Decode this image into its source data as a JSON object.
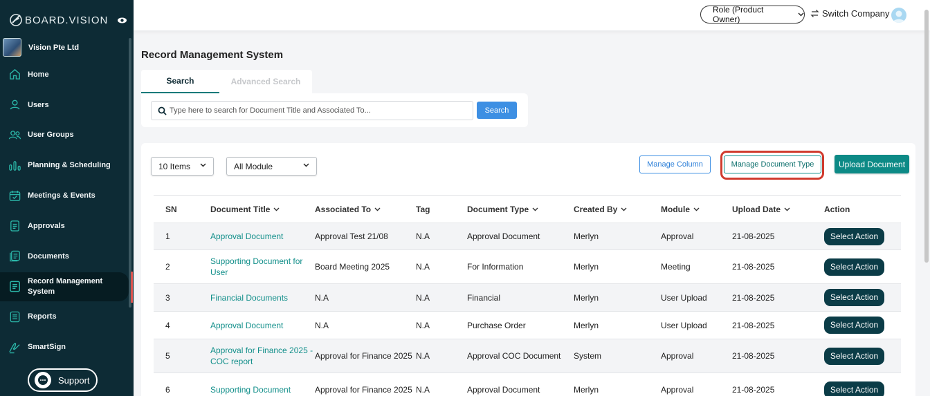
{
  "app": {
    "logo_text": "BOARD.VISION",
    "company_name": "Vision Pte Ltd"
  },
  "sidebar": {
    "items": [
      {
        "label": "Home",
        "icon": "home-icon"
      },
      {
        "label": "Users",
        "icon": "user-icon"
      },
      {
        "label": "User Groups",
        "icon": "user-groups-icon"
      },
      {
        "label": "Planning & Scheduling",
        "icon": "bar-chart-icon"
      },
      {
        "label": "Meetings & Events",
        "icon": "calendar-icon"
      },
      {
        "label": "Approvals",
        "icon": "clipboard-icon"
      },
      {
        "label": "Documents",
        "icon": "documents-icon"
      },
      {
        "label": "Record Management System",
        "icon": "record-icon",
        "active": true
      },
      {
        "label": "Reports",
        "icon": "report-icon"
      },
      {
        "label": "SmartSign",
        "icon": "signature-icon"
      }
    ],
    "support_label": "Support"
  },
  "topbar": {
    "role_label": "Role (Product Owner)",
    "switch_company_label": "Switch Company"
  },
  "main": {
    "title": "Record Management System",
    "tabs": {
      "search": "Search",
      "advanced": "Advanced Search"
    },
    "search": {
      "placeholder": "Type here to search for Document Title and Associated To...",
      "button_label": "Search"
    },
    "filters": {
      "items_per_page": "10 Items",
      "module": "All Module"
    },
    "buttons": {
      "manage_column": "Manage Column",
      "manage_document_type": "Manage Document Type",
      "upload_document": "Upload Document"
    },
    "table": {
      "headers": {
        "sn": "SN",
        "title": "Document Title",
        "associated": "Associated To",
        "tag": "Tag",
        "type": "Document Type",
        "created": "Created By",
        "module": "Module",
        "date": "Upload Date",
        "action": "Action"
      },
      "rows": [
        {
          "sn": "1",
          "title": "Approval Document",
          "associated": "Approval Test 21/08",
          "tag": "N.A",
          "type": "Approval Document",
          "created": "Merlyn",
          "module": "Approval",
          "date": "21-08-2025",
          "action": "Select Action"
        },
        {
          "sn": "2",
          "title": "Supporting Document for User",
          "associated": "Board Meeting 2025",
          "tag": "N.A",
          "type": "For Information",
          "created": "Merlyn",
          "module": "Meeting",
          "date": "21-08-2025",
          "action": "Select Action"
        },
        {
          "sn": "3",
          "title": "Financial Documents",
          "associated": "N.A",
          "tag": "N.A",
          "type": "Financial",
          "created": "Merlyn",
          "module": "User Upload",
          "date": "21-08-2025",
          "action": "Select Action"
        },
        {
          "sn": "4",
          "title": "Approval Document",
          "associated": "N.A",
          "tag": "N.A",
          "type": "Purchase Order",
          "created": "Merlyn",
          "module": "User Upload",
          "date": "21-08-2025",
          "action": "Select Action"
        },
        {
          "sn": "5",
          "title": "Approval for Finance 2025 - COC report",
          "associated": "Approval for Finance 2025",
          "tag": "N.A",
          "type": "Approval COC Document",
          "created": "System",
          "module": "Approval",
          "date": "21-08-2025",
          "action": "Select Action"
        },
        {
          "sn": "6",
          "title": "Supporting Document",
          "associated": "Approval for Finance 2025",
          "tag": "N.A",
          "type": "Approval Document",
          "created": "Merlyn",
          "module": "Approval",
          "date": "21-08-2025",
          "action": "Select Action"
        }
      ]
    }
  },
  "colors": {
    "sidebar_bg": "#0d2b35",
    "accent_teal": "#0d8a86",
    "action_btn": "#0b3c47",
    "search_btn": "#3d8fe3",
    "highlight": "#d03b2e"
  }
}
